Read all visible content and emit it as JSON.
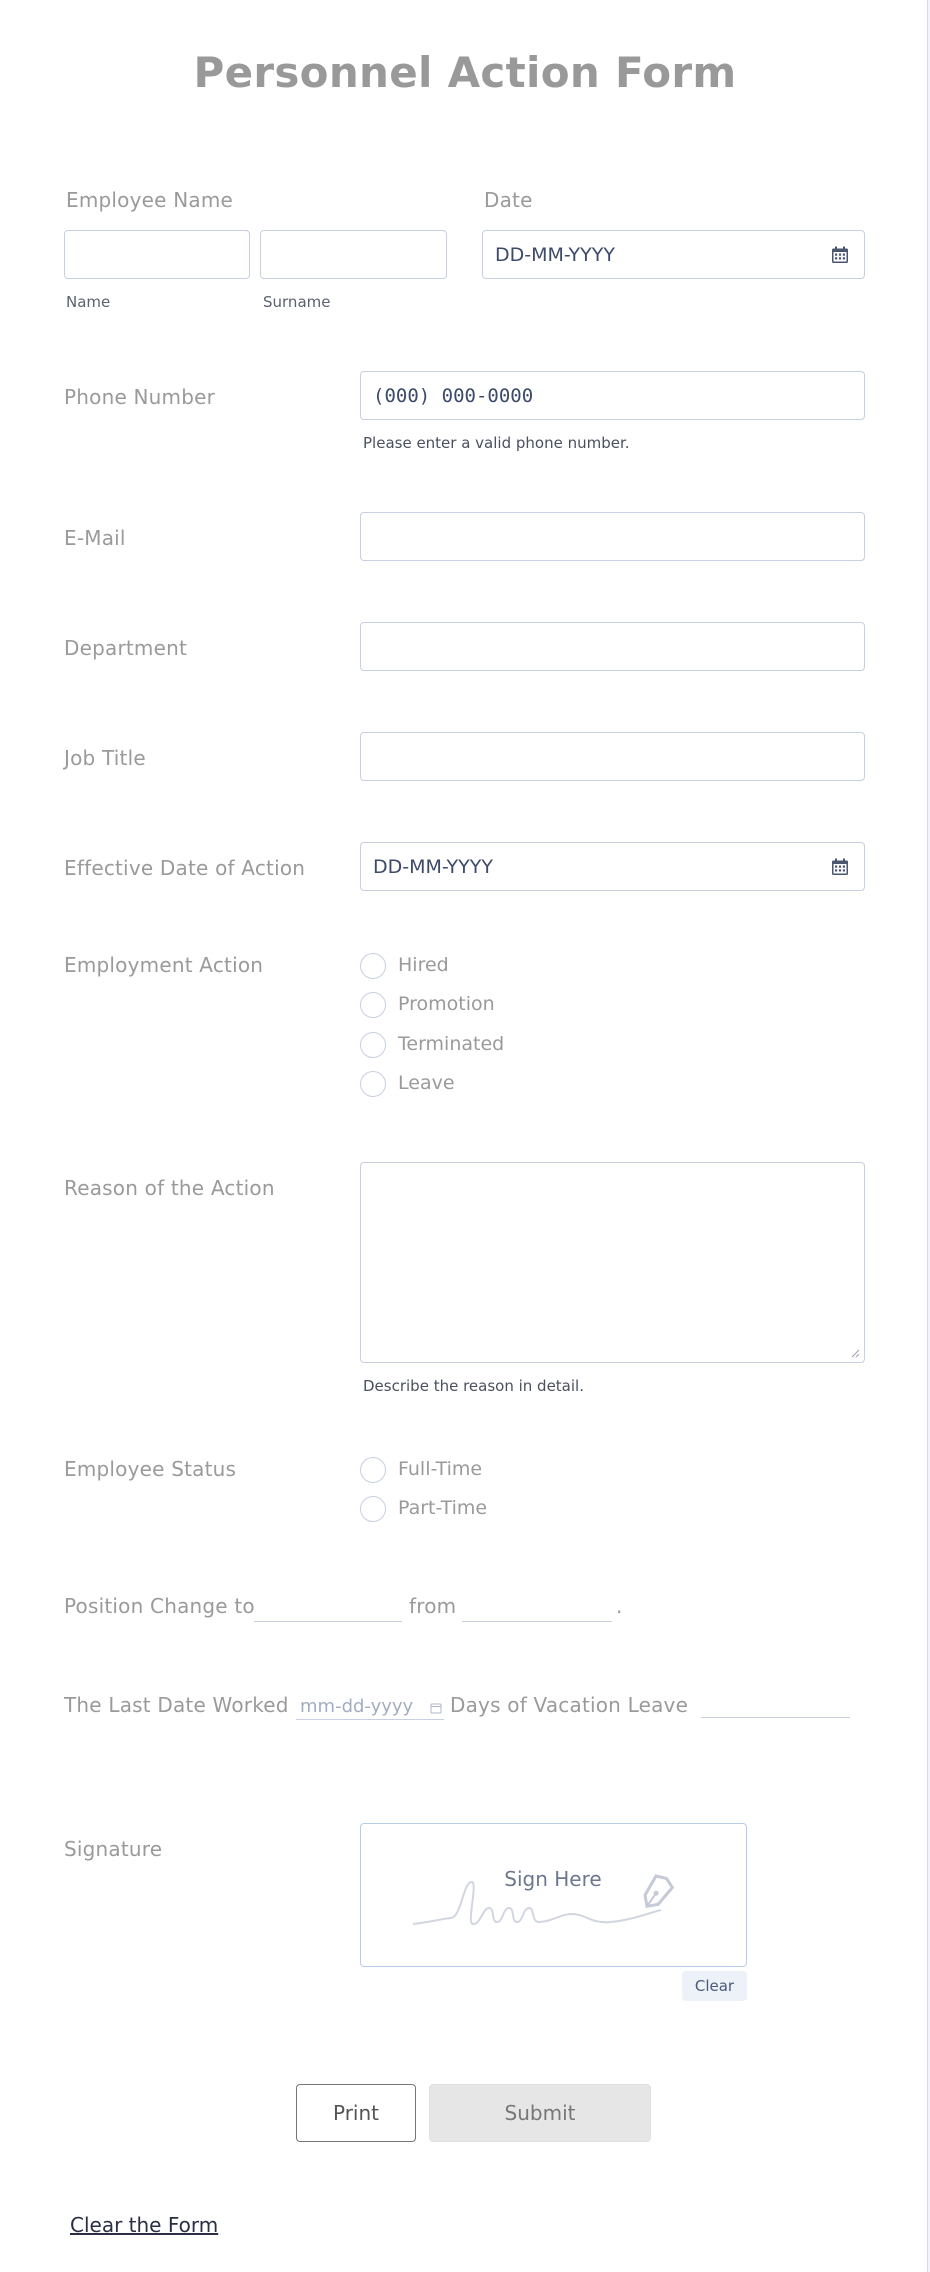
{
  "form": {
    "title": "Personnel Action Form"
  },
  "employee_name": {
    "label": "Employee Name",
    "first_sublabel": "Name",
    "last_sublabel": "Surname",
    "first_value": "",
    "last_value": ""
  },
  "date": {
    "label": "Date",
    "placeholder": "DD-MM-YYYY",
    "icon": "calendar-icon"
  },
  "phone": {
    "label": "Phone Number",
    "placeholder": "(000) 000-0000",
    "hint": "Please enter a valid phone number."
  },
  "email": {
    "label": "E-Mail",
    "value": ""
  },
  "department": {
    "label": "Department",
    "value": ""
  },
  "job_title": {
    "label": "Job Title",
    "value": ""
  },
  "effective_date": {
    "label": "Effective Date of Action",
    "placeholder": "DD-MM-YYYY",
    "icon": "calendar-icon"
  },
  "employment_action": {
    "label": "Employment Action",
    "options": [
      "Hired",
      "Promotion",
      "Terminated",
      "Leave"
    ]
  },
  "reason": {
    "label": "Reason of the Action",
    "hint": "Describe the reason in detail.",
    "value": ""
  },
  "employee_status": {
    "label": "Employee Status",
    "options": [
      "Full-Time",
      "Part-Time"
    ]
  },
  "position_change": {
    "prefix": "Position Change to",
    "middle": "from",
    "suffix": "."
  },
  "last_date": {
    "label": "The Last Date Worked",
    "placeholder": "mm-dd-yyyy",
    "vacation_label": "Days of Vacation Leave"
  },
  "signature": {
    "label": "Signature",
    "prompt": "Sign Here",
    "clear_label": "Clear"
  },
  "actions": {
    "print_label": "Print",
    "submit_label": "Submit",
    "clear_form_label": "Clear the Form"
  },
  "colors": {
    "border": "#c8cfe0",
    "label": "#9a9a9a",
    "placeholder": "#3d4a6a",
    "background": "#f3f3fe"
  }
}
